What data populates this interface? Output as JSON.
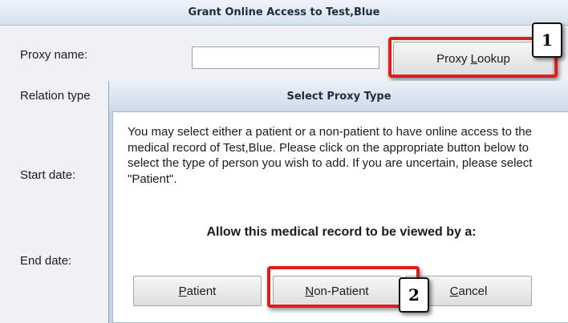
{
  "outer_dialog": {
    "title": "Grant Online Access to Test,Blue",
    "labels": {
      "proxy_name": "Proxy name:",
      "relation_type": "Relation type",
      "start_date": "Start date:",
      "end_date": "End date:"
    },
    "proxy_name_value": "",
    "proxy_lookup_button": {
      "pre": "Proxy ",
      "mnemonic": "L",
      "post": "ookup"
    }
  },
  "inner_dialog": {
    "title": "Select Proxy Type",
    "message": "You may select either a patient or a non-patient to have online access to the medical record of Test,Blue. Please click on the appropriate button below to select the type of person you wish to add. If you are uncertain, please select \"Patient\".",
    "prompt": "Allow this medical record to be viewed by a:",
    "buttons": {
      "patient": {
        "mnemonic": "P",
        "rest": "atient"
      },
      "non_patient": {
        "mnemonic": "N",
        "rest": "on-Patient"
      },
      "cancel": {
        "mnemonic": "C",
        "rest": "ancel"
      }
    }
  },
  "callouts": {
    "first": "1",
    "second": "2"
  },
  "colors": {
    "highlight": "#e21b1b",
    "titlebar": "#d6e1ee",
    "dialog_frame": "#c3d2e4"
  }
}
